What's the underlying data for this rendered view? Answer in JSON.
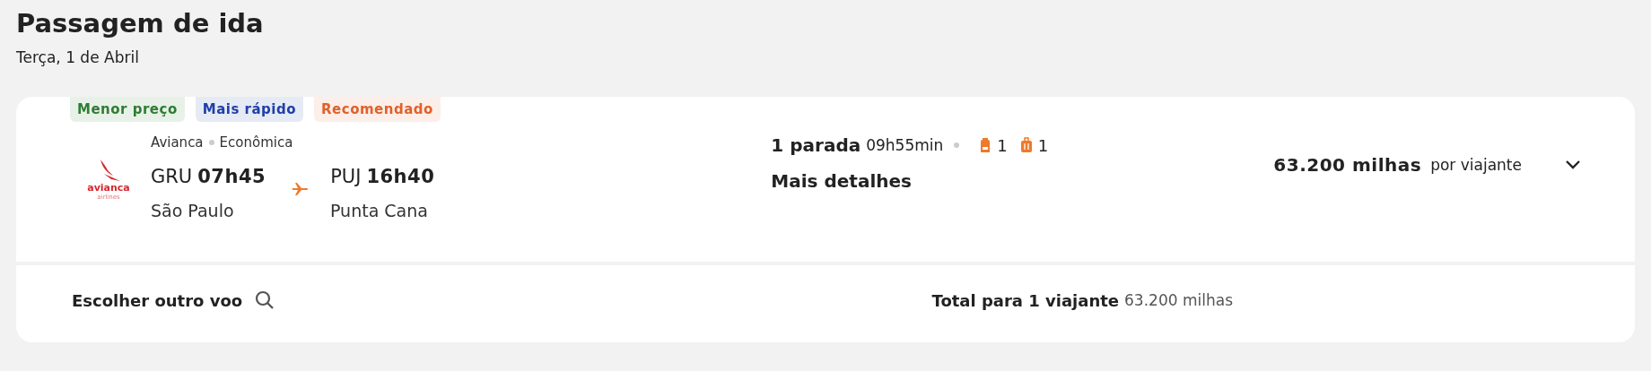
{
  "header": {
    "title": "Passagem de ida",
    "date": "Terça, 1 de Abril"
  },
  "flight": {
    "tags": [
      {
        "label": "Menor preço",
        "color": "#2e7d32"
      },
      {
        "label": "Mais rápido",
        "color": "#1f3fa8"
      },
      {
        "label": "Recomendado",
        "color": "#e0612a"
      }
    ],
    "airline": {
      "logo_text": "avianca",
      "logo_subtext": "airlines",
      "name": "Avianca",
      "cabin": "Econômica"
    },
    "departure": {
      "code": "GRU",
      "time": "07h45",
      "city": "São Paulo"
    },
    "arrival": {
      "code": "PUJ",
      "time": "16h40",
      "city": "Punta Cana"
    },
    "stops": "1 parada",
    "duration": "09h55min",
    "baggage": [
      {
        "kind": "backpack",
        "count": "1"
      },
      {
        "kind": "suitcase",
        "count": "1"
      }
    ],
    "details_link": "Mais detalhes",
    "price": "63.200 milhas",
    "price_unit": "por viajante",
    "expanded": false
  },
  "footer": {
    "choose_other": "Escolher outro voo",
    "total_label": "Total para 1 viajante",
    "total_value": "63.200 milhas"
  }
}
